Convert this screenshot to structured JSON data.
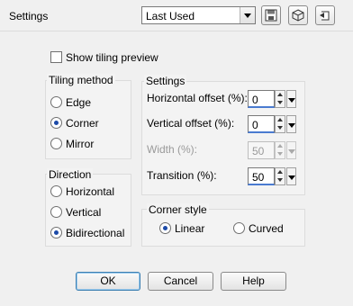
{
  "header": {
    "settings_label": "Settings",
    "preset_value": "Last Used"
  },
  "preview": {
    "label": "Show tiling preview",
    "checked": false
  },
  "tiling_method": {
    "title": "Tiling method",
    "options": [
      "Edge",
      "Corner",
      "Mirror"
    ],
    "selected": "Corner"
  },
  "direction": {
    "title": "Direction",
    "options": [
      "Horizontal",
      "Vertical",
      "Bidirectional"
    ],
    "selected": "Bidirectional"
  },
  "settings": {
    "title": "Settings",
    "horizontal_offset": {
      "label": "Horizontal offset (%):",
      "value": "0"
    },
    "vertical_offset": {
      "label": "Vertical offset (%):",
      "value": "0"
    },
    "width": {
      "label": "Width (%):",
      "value": "50",
      "disabled": true
    },
    "transition": {
      "label": "Transition (%):",
      "value": "50"
    }
  },
  "corner_style": {
    "title": "Corner style",
    "options": [
      "Linear",
      "Curved"
    ],
    "selected": "Linear"
  },
  "buttons": {
    "ok": "OK",
    "cancel": "Cancel",
    "help": "Help"
  }
}
